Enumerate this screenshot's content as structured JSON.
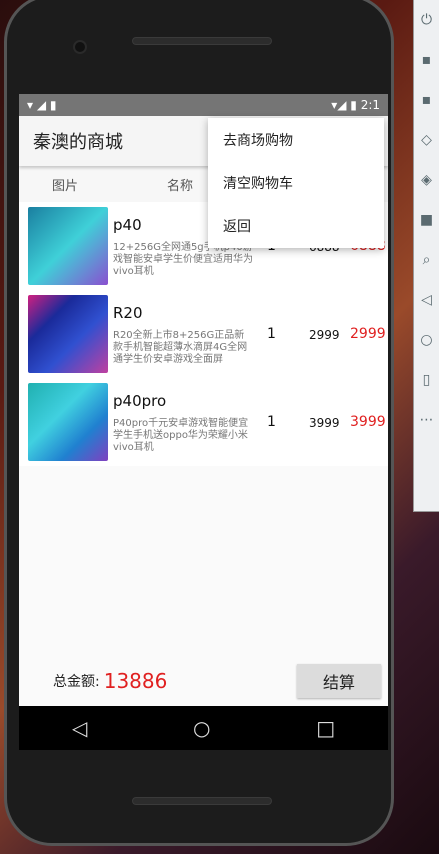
{
  "status": {
    "time": "2:1"
  },
  "toolbar": {
    "title": "秦澳的商城"
  },
  "columns": [
    "图片",
    "名称"
  ],
  "menu": [
    "去商场购物",
    "清空购物车",
    "返回"
  ],
  "items": [
    {
      "name": "p40",
      "desc": "12+256G全网通5g手机p40游戏智能安卓学生价便宜适用华为vivo耳机",
      "qty": "1",
      "price": "6888",
      "total": "6888"
    },
    {
      "name": "R20",
      "desc": "R20全新上市8+256G正品新款手机智能超薄水滴屏4G全网通学生价安卓游戏全面屏",
      "qty": "1",
      "price": "2999",
      "total": "2999"
    },
    {
      "name": "p40pro",
      "desc": "P40pro千元安卓游戏智能便宜学生手机送oppo华为荣耀小米vivo耳机",
      "qty": "1",
      "price": "3999",
      "total": "3999"
    }
  ],
  "footer": {
    "total_label": "总金额:",
    "total_value": "13886",
    "checkout": "结算"
  },
  "colors": {
    "accent": "#e02020"
  }
}
